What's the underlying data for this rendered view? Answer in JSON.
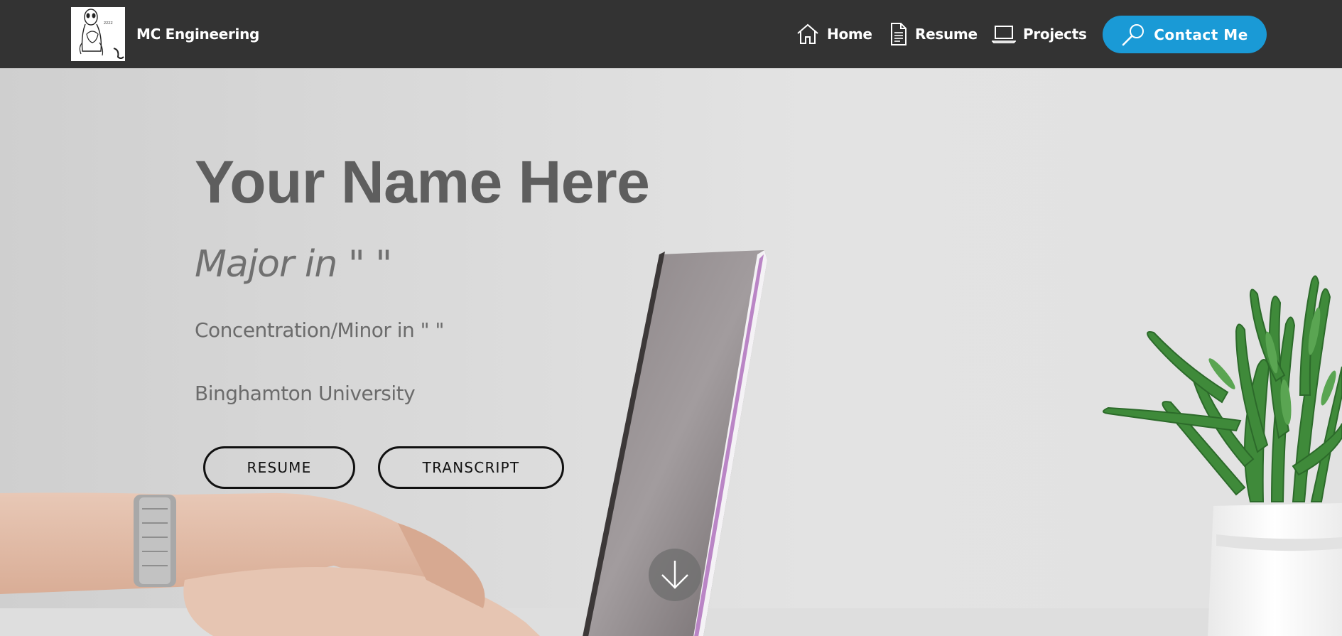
{
  "brand": {
    "name": "MC Engineering",
    "logo_icon": "alien-cat-sketch-logo"
  },
  "nav": {
    "items": [
      {
        "label": "Home",
        "icon": "home-icon"
      },
      {
        "label": "Resume",
        "icon": "document-icon"
      },
      {
        "label": "Projects",
        "icon": "laptop-icon"
      }
    ],
    "contact": {
      "label": "Contact Me",
      "icon": "magnifier-icon"
    }
  },
  "hero": {
    "name": "Your Name Here",
    "major": "Major in \" \"",
    "minor": "Concentration/Minor in \" \"",
    "school": "Binghamton University",
    "buttons": {
      "resume": "RESUME",
      "transcript": "TRANSCRIPT"
    },
    "scroll_icon": "arrow-down-icon"
  },
  "colors": {
    "navbar_bg": "#333333",
    "accent": "#1a9ad6",
    "text_dark": "#5e5e5e",
    "text_muted": "#6b6b6b"
  }
}
